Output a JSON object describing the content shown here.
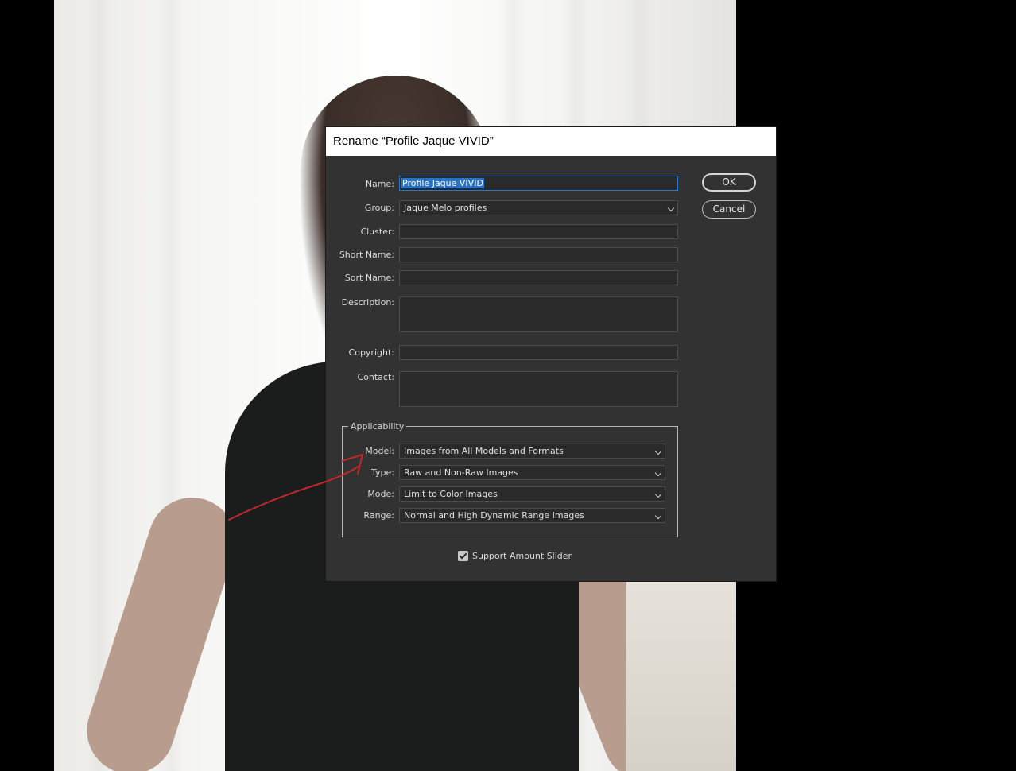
{
  "dialog": {
    "title": "Rename “Profile Jaque VIVID”",
    "ok_label": "OK",
    "cancel_label": "Cancel"
  },
  "fields": {
    "name_label": "Name:",
    "name_value": "Profile Jaque VIVID",
    "group_label": "Group:",
    "group_value": "Jaque Melo profiles",
    "cluster_label": "Cluster:",
    "cluster_value": "",
    "short_name_label": "Short Name:",
    "short_name_value": "",
    "sort_name_label": "Sort Name:",
    "sort_name_value": "",
    "description_label": "Description:",
    "description_value": "",
    "copyright_label": "Copyright:",
    "copyright_value": "",
    "contact_label": "Contact:",
    "contact_value": ""
  },
  "applicability": {
    "title": "Applicability",
    "model_label": "Model:",
    "model_value": "Images from All Models and Formats",
    "type_label": "Type:",
    "type_value": "Raw and Non-Raw Images",
    "mode_label": "Mode:",
    "mode_value": "Limit to Color Images",
    "range_label": "Range:",
    "range_value": "Normal and High Dynamic Range Images"
  },
  "support_amount_slider": {
    "label": "Support Amount Slider",
    "checked": true
  },
  "colors": {
    "dialog_bg": "#323232",
    "field_bg": "#2a2a2a",
    "selection": "#2a72c4",
    "annotation": "#c0282d"
  }
}
